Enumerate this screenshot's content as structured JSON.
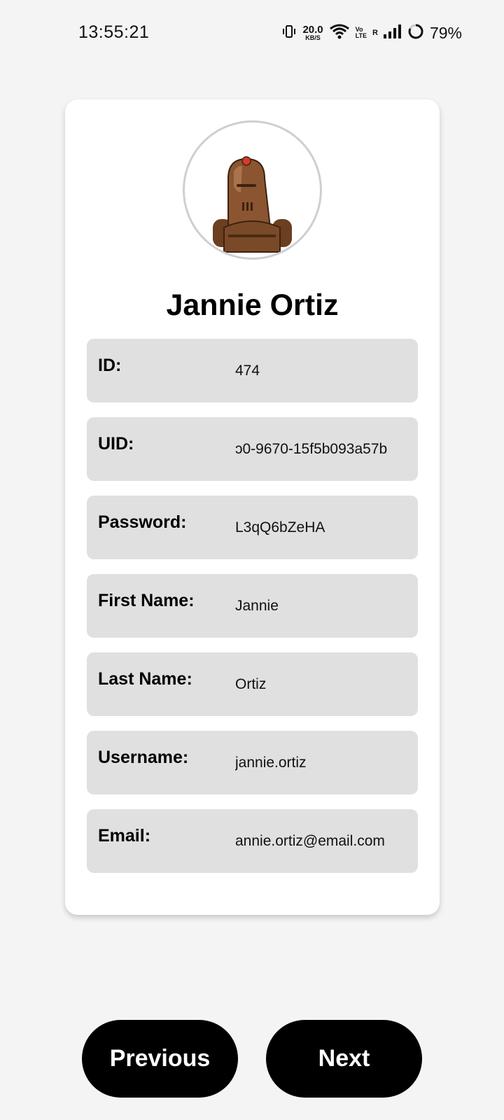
{
  "status_bar": {
    "time": "13:55:21",
    "net_speed_value": "20.0",
    "net_speed_unit": "KB/S",
    "volte_top": "Vo",
    "volte_bottom": "LTE",
    "roaming": "R",
    "battery_percent": "79%"
  },
  "profile": {
    "name": "Jannie Ortiz",
    "avatar_icon": "robot-avatar-icon",
    "fields": [
      {
        "label": "ID:",
        "value": "474"
      },
      {
        "label": "UID:",
        "value": "ɔ0-9670-15f5b093a57b"
      },
      {
        "label": "Password:",
        "value": "L3qQ6bZeHA"
      },
      {
        "label": "First Name:",
        "value": "Jannie"
      },
      {
        "label": "Last Name:",
        "value": "Ortiz"
      },
      {
        "label": "Username:",
        "value": "jannie.ortiz"
      },
      {
        "label": "Email:",
        "value": "annie.ortiz@email.com"
      }
    ]
  },
  "navigation": {
    "previous_label": "Previous",
    "next_label": "Next"
  },
  "colors": {
    "background": "#f4f4f4",
    "card": "#ffffff",
    "field_background": "#e0e0e0",
    "button": "#000000",
    "button_text": "#ffffff"
  }
}
